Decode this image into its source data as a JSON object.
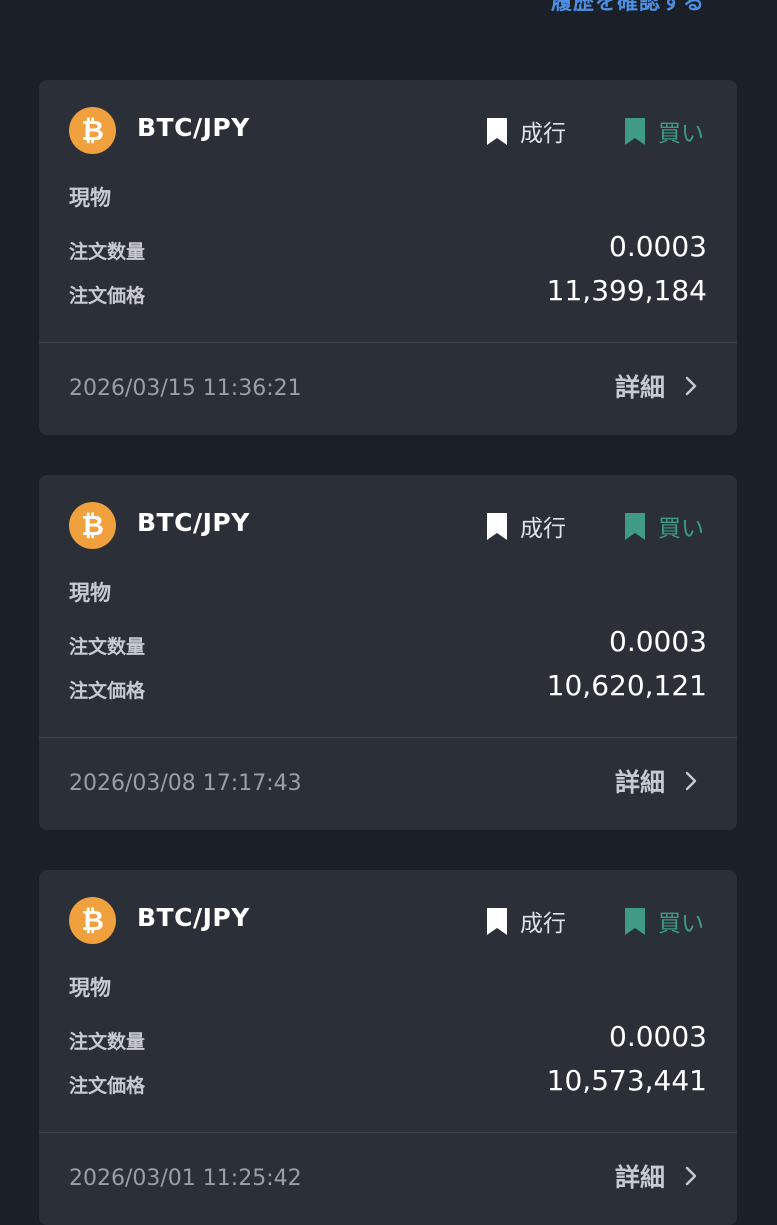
{
  "header": {
    "history_link": "履歴を確認する"
  },
  "orders": [
    {
      "pair": "BTC/JPY",
      "order_type": "成行",
      "side": "買い",
      "market": "現物",
      "quantity_label": "注文数量",
      "quantity": "0.0003",
      "price_label": "注文価格",
      "price": "11,399,184",
      "timestamp": "2026/03/15 11:36:21",
      "detail_label": "詳細"
    },
    {
      "pair": "BTC/JPY",
      "order_type": "成行",
      "side": "買い",
      "market": "現物",
      "quantity_label": "注文数量",
      "quantity": "0.0003",
      "price_label": "注文価格",
      "price": "10,620,121",
      "timestamp": "2026/03/08 17:17:43",
      "detail_label": "詳細"
    },
    {
      "pair": "BTC/JPY",
      "order_type": "成行",
      "side": "買い",
      "market": "現物",
      "quantity_label": "注文数量",
      "quantity": "0.0003",
      "price_label": "注文価格",
      "price": "10,573,441",
      "timestamp": "2026/03/01 11:25:42",
      "detail_label": "詳細"
    }
  ],
  "icons": {
    "coin": "bitcoin-icon",
    "order_type": "bookmark-icon",
    "side": "bookmark-icon",
    "detail": "chevron-right-icon"
  },
  "colors": {
    "background": "#1b1f27",
    "card": "#2b2f37",
    "link": "#4d8fe0",
    "buy": "#3f9a86",
    "bitcoin": "#f0a03c"
  }
}
